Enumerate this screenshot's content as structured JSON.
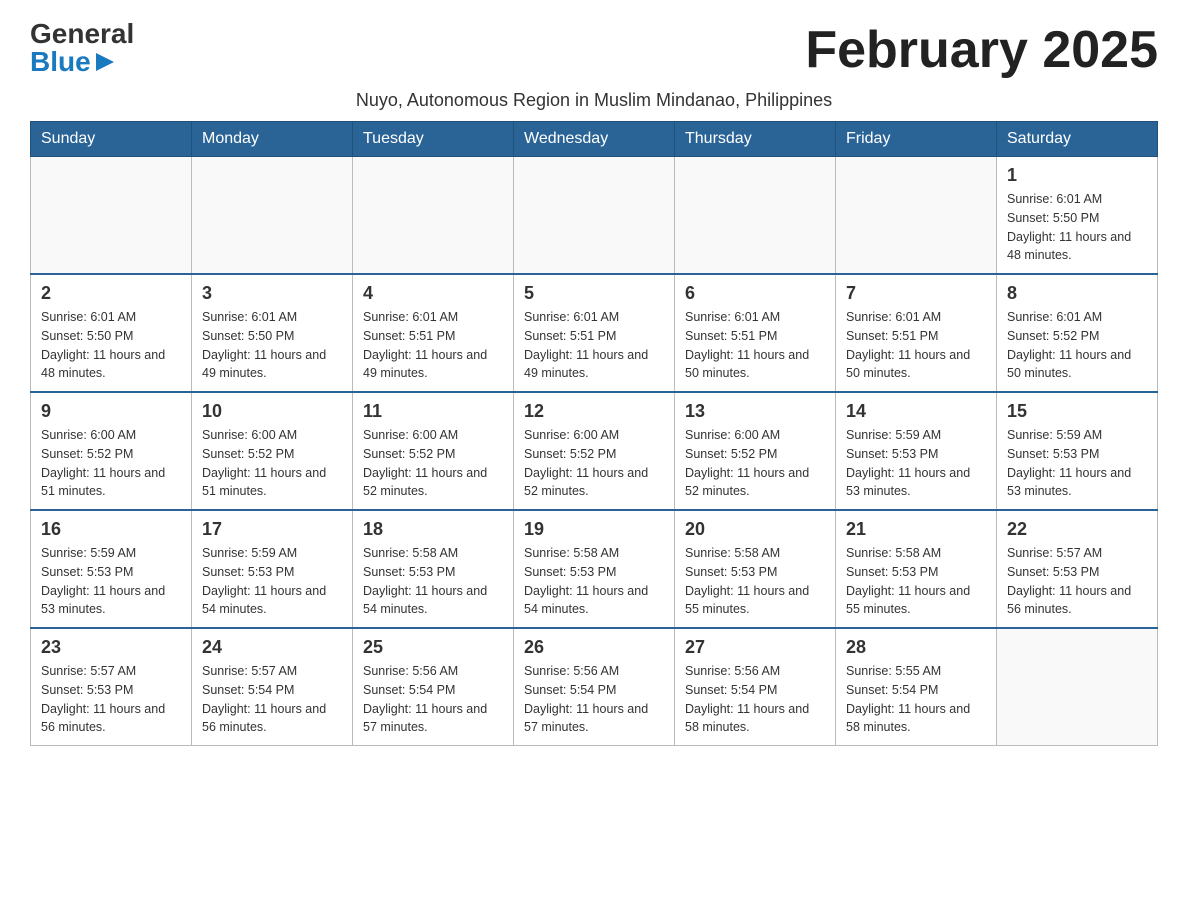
{
  "header": {
    "logo_general": "General",
    "logo_blue": "Blue",
    "month_title": "February 2025",
    "subtitle": "Nuyo, Autonomous Region in Muslim Mindanao, Philippines"
  },
  "days_of_week": [
    "Sunday",
    "Monday",
    "Tuesday",
    "Wednesday",
    "Thursday",
    "Friday",
    "Saturday"
  ],
  "weeks": [
    [
      {
        "day": "",
        "sunrise": "",
        "sunset": "",
        "daylight": ""
      },
      {
        "day": "",
        "sunrise": "",
        "sunset": "",
        "daylight": ""
      },
      {
        "day": "",
        "sunrise": "",
        "sunset": "",
        "daylight": ""
      },
      {
        "day": "",
        "sunrise": "",
        "sunset": "",
        "daylight": ""
      },
      {
        "day": "",
        "sunrise": "",
        "sunset": "",
        "daylight": ""
      },
      {
        "day": "",
        "sunrise": "",
        "sunset": "",
        "daylight": ""
      },
      {
        "day": "1",
        "sunrise": "Sunrise: 6:01 AM",
        "sunset": "Sunset: 5:50 PM",
        "daylight": "Daylight: 11 hours and 48 minutes."
      }
    ],
    [
      {
        "day": "2",
        "sunrise": "Sunrise: 6:01 AM",
        "sunset": "Sunset: 5:50 PM",
        "daylight": "Daylight: 11 hours and 48 minutes."
      },
      {
        "day": "3",
        "sunrise": "Sunrise: 6:01 AM",
        "sunset": "Sunset: 5:50 PM",
        "daylight": "Daylight: 11 hours and 49 minutes."
      },
      {
        "day": "4",
        "sunrise": "Sunrise: 6:01 AM",
        "sunset": "Sunset: 5:51 PM",
        "daylight": "Daylight: 11 hours and 49 minutes."
      },
      {
        "day": "5",
        "sunrise": "Sunrise: 6:01 AM",
        "sunset": "Sunset: 5:51 PM",
        "daylight": "Daylight: 11 hours and 49 minutes."
      },
      {
        "day": "6",
        "sunrise": "Sunrise: 6:01 AM",
        "sunset": "Sunset: 5:51 PM",
        "daylight": "Daylight: 11 hours and 50 minutes."
      },
      {
        "day": "7",
        "sunrise": "Sunrise: 6:01 AM",
        "sunset": "Sunset: 5:51 PM",
        "daylight": "Daylight: 11 hours and 50 minutes."
      },
      {
        "day": "8",
        "sunrise": "Sunrise: 6:01 AM",
        "sunset": "Sunset: 5:52 PM",
        "daylight": "Daylight: 11 hours and 50 minutes."
      }
    ],
    [
      {
        "day": "9",
        "sunrise": "Sunrise: 6:00 AM",
        "sunset": "Sunset: 5:52 PM",
        "daylight": "Daylight: 11 hours and 51 minutes."
      },
      {
        "day": "10",
        "sunrise": "Sunrise: 6:00 AM",
        "sunset": "Sunset: 5:52 PM",
        "daylight": "Daylight: 11 hours and 51 minutes."
      },
      {
        "day": "11",
        "sunrise": "Sunrise: 6:00 AM",
        "sunset": "Sunset: 5:52 PM",
        "daylight": "Daylight: 11 hours and 52 minutes."
      },
      {
        "day": "12",
        "sunrise": "Sunrise: 6:00 AM",
        "sunset": "Sunset: 5:52 PM",
        "daylight": "Daylight: 11 hours and 52 minutes."
      },
      {
        "day": "13",
        "sunrise": "Sunrise: 6:00 AM",
        "sunset": "Sunset: 5:52 PM",
        "daylight": "Daylight: 11 hours and 52 minutes."
      },
      {
        "day": "14",
        "sunrise": "Sunrise: 5:59 AM",
        "sunset": "Sunset: 5:53 PM",
        "daylight": "Daylight: 11 hours and 53 minutes."
      },
      {
        "day": "15",
        "sunrise": "Sunrise: 5:59 AM",
        "sunset": "Sunset: 5:53 PM",
        "daylight": "Daylight: 11 hours and 53 minutes."
      }
    ],
    [
      {
        "day": "16",
        "sunrise": "Sunrise: 5:59 AM",
        "sunset": "Sunset: 5:53 PM",
        "daylight": "Daylight: 11 hours and 53 minutes."
      },
      {
        "day": "17",
        "sunrise": "Sunrise: 5:59 AM",
        "sunset": "Sunset: 5:53 PM",
        "daylight": "Daylight: 11 hours and 54 minutes."
      },
      {
        "day": "18",
        "sunrise": "Sunrise: 5:58 AM",
        "sunset": "Sunset: 5:53 PM",
        "daylight": "Daylight: 11 hours and 54 minutes."
      },
      {
        "day": "19",
        "sunrise": "Sunrise: 5:58 AM",
        "sunset": "Sunset: 5:53 PM",
        "daylight": "Daylight: 11 hours and 54 minutes."
      },
      {
        "day": "20",
        "sunrise": "Sunrise: 5:58 AM",
        "sunset": "Sunset: 5:53 PM",
        "daylight": "Daylight: 11 hours and 55 minutes."
      },
      {
        "day": "21",
        "sunrise": "Sunrise: 5:58 AM",
        "sunset": "Sunset: 5:53 PM",
        "daylight": "Daylight: 11 hours and 55 minutes."
      },
      {
        "day": "22",
        "sunrise": "Sunrise: 5:57 AM",
        "sunset": "Sunset: 5:53 PM",
        "daylight": "Daylight: 11 hours and 56 minutes."
      }
    ],
    [
      {
        "day": "23",
        "sunrise": "Sunrise: 5:57 AM",
        "sunset": "Sunset: 5:53 PM",
        "daylight": "Daylight: 11 hours and 56 minutes."
      },
      {
        "day": "24",
        "sunrise": "Sunrise: 5:57 AM",
        "sunset": "Sunset: 5:54 PM",
        "daylight": "Daylight: 11 hours and 56 minutes."
      },
      {
        "day": "25",
        "sunrise": "Sunrise: 5:56 AM",
        "sunset": "Sunset: 5:54 PM",
        "daylight": "Daylight: 11 hours and 57 minutes."
      },
      {
        "day": "26",
        "sunrise": "Sunrise: 5:56 AM",
        "sunset": "Sunset: 5:54 PM",
        "daylight": "Daylight: 11 hours and 57 minutes."
      },
      {
        "day": "27",
        "sunrise": "Sunrise: 5:56 AM",
        "sunset": "Sunset: 5:54 PM",
        "daylight": "Daylight: 11 hours and 58 minutes."
      },
      {
        "day": "28",
        "sunrise": "Sunrise: 5:55 AM",
        "sunset": "Sunset: 5:54 PM",
        "daylight": "Daylight: 11 hours and 58 minutes."
      },
      {
        "day": "",
        "sunrise": "",
        "sunset": "",
        "daylight": ""
      }
    ]
  ],
  "colors": {
    "header_bg": "#2a6496",
    "header_text": "#ffffff",
    "border": "#999999",
    "cell_border": "#bbbbbb",
    "day_number": "#333333",
    "day_info": "#333333",
    "logo_blue": "#1a7abf"
  }
}
